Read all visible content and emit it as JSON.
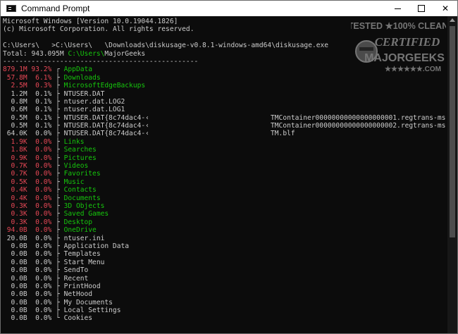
{
  "window": {
    "title": "Command Prompt",
    "minimize": "—",
    "maximize": "☐",
    "close": "✕"
  },
  "header_lines": [
    "Microsoft Windows [Version 10.0.19044.1826]",
    "(c) Microsoft Corporation. All rights reserved.",
    "",
    "C:\\Users\\   >C:\\Users\\   \\Downloads\\diskusage-v0.8.1-windows-amd64\\diskusage.exe"
  ],
  "total": {
    "label": "Total:",
    "size": "943.095M",
    "path": "C:\\Users\\",
    "user": "MajorGeeks"
  },
  "separator": "------------------------------------------------",
  "colors": {
    "red": "#e74856",
    "green": "#16c60c",
    "gray": "#cccccc",
    "background": "#0c0c0c"
  },
  "entries": [
    {
      "size": "879.1M",
      "pct": "93.2%",
      "tree": "┌",
      "name": "AppData",
      "color": "red",
      "extra": ""
    },
    {
      "size": "57.8M",
      "pct": "6.1%",
      "tree": "├",
      "name": "Downloads",
      "color": "red",
      "extra": ""
    },
    {
      "size": "2.5M",
      "pct": "0.3%",
      "tree": "├",
      "name": "MicrosoftEdgeBackups",
      "color": "red",
      "extra": ""
    },
    {
      "size": "1.2M",
      "pct": "0.1%",
      "tree": "├",
      "name": "NTUSER.DAT",
      "color": "gray",
      "extra": ""
    },
    {
      "size": "0.8M",
      "pct": "0.1%",
      "tree": "├",
      "name": "ntuser.dat.LOG2",
      "color": "gray",
      "extra": ""
    },
    {
      "size": "0.6M",
      "pct": "0.1%",
      "tree": "├",
      "name": "ntuser.dat.LOG1",
      "color": "gray",
      "extra": ""
    },
    {
      "size": "0.5M",
      "pct": "0.1%",
      "tree": "├",
      "name": "NTUSER.DAT{8c74dac4-‹",
      "color": "gray",
      "extra": "TMContainer00000000000000000001.regtrans-ms"
    },
    {
      "size": "0.5M",
      "pct": "0.1%",
      "tree": "├",
      "name": "NTUSER.DAT{8c74dac4-‹",
      "color": "gray",
      "extra": "TMContainer00000000000000000002.regtrans-ms"
    },
    {
      "size": "64.0K",
      "pct": "0.0%",
      "tree": "├",
      "name": "NTUSER.DAT{8c74dac4-‹",
      "color": "gray",
      "extra": "TM.blf"
    },
    {
      "size": "1.9K",
      "pct": "0.0%",
      "tree": "├",
      "name": "Links",
      "color": "red",
      "extra": ""
    },
    {
      "size": "1.8K",
      "pct": "0.0%",
      "tree": "├",
      "name": "Searches",
      "color": "red",
      "extra": ""
    },
    {
      "size": "0.9K",
      "pct": "0.0%",
      "tree": "├",
      "name": "Pictures",
      "color": "red",
      "extra": ""
    },
    {
      "size": "0.7K",
      "pct": "0.0%",
      "tree": "├",
      "name": "Videos",
      "color": "red",
      "extra": ""
    },
    {
      "size": "0.7K",
      "pct": "0.0%",
      "tree": "├",
      "name": "Favorites",
      "color": "red",
      "extra": ""
    },
    {
      "size": "0.5K",
      "pct": "0.0%",
      "tree": "├",
      "name": "Music",
      "color": "red",
      "extra": ""
    },
    {
      "size": "0.4K",
      "pct": "0.0%",
      "tree": "├",
      "name": "Contacts",
      "color": "red",
      "extra": ""
    },
    {
      "size": "0.4K",
      "pct": "0.0%",
      "tree": "├",
      "name": "Documents",
      "color": "red",
      "extra": ""
    },
    {
      "size": "0.3K",
      "pct": "0.0%",
      "tree": "├",
      "name": "3D Objects",
      "color": "red",
      "extra": ""
    },
    {
      "size": "0.3K",
      "pct": "0.0%",
      "tree": "├",
      "name": "Saved Games",
      "color": "red",
      "extra": ""
    },
    {
      "size": "0.3K",
      "pct": "0.0%",
      "tree": "├",
      "name": "Desktop",
      "color": "red",
      "extra": ""
    },
    {
      "size": "94.0B",
      "pct": "0.0%",
      "tree": "├",
      "name": "OneDrive",
      "color": "red",
      "extra": ""
    },
    {
      "size": "20.0B",
      "pct": "0.0%",
      "tree": "├",
      "name": "ntuser.ini",
      "color": "gray",
      "extra": ""
    },
    {
      "size": "0.0B",
      "pct": "0.0%",
      "tree": "├",
      "name": "Application Data",
      "color": "gray",
      "extra": ""
    },
    {
      "size": "0.0B",
      "pct": "0.0%",
      "tree": "├",
      "name": "Templates",
      "color": "gray",
      "extra": ""
    },
    {
      "size": "0.0B",
      "pct": "0.0%",
      "tree": "├",
      "name": "Start Menu",
      "color": "gray",
      "extra": ""
    },
    {
      "size": "0.0B",
      "pct": "0.0%",
      "tree": "├",
      "name": "SendTo",
      "color": "gray",
      "extra": ""
    },
    {
      "size": "0.0B",
      "pct": "0.0%",
      "tree": "├",
      "name": "Recent",
      "color": "gray",
      "extra": ""
    },
    {
      "size": "0.0B",
      "pct": "0.0%",
      "tree": "├",
      "name": "PrintHood",
      "color": "gray",
      "extra": ""
    },
    {
      "size": "0.0B",
      "pct": "0.0%",
      "tree": "├",
      "name": "NetHood",
      "color": "gray",
      "extra": ""
    },
    {
      "size": "0.0B",
      "pct": "0.0%",
      "tree": "├",
      "name": "My Documents",
      "color": "gray",
      "extra": ""
    },
    {
      "size": "0.0B",
      "pct": "0.0%",
      "tree": "├",
      "name": "Local Settings",
      "color": "gray",
      "extra": ""
    },
    {
      "size": "0.0B",
      "pct": "0.0%",
      "tree": "└",
      "name": "Cookies",
      "color": "gray",
      "extra": ""
    }
  ],
  "watermark": {
    "line1": "TESTED ★100% CLEAN",
    "line2": "CERTIFIED",
    "line3": "MAJORGEEKS",
    "line4": "★★★★★★.COM"
  }
}
